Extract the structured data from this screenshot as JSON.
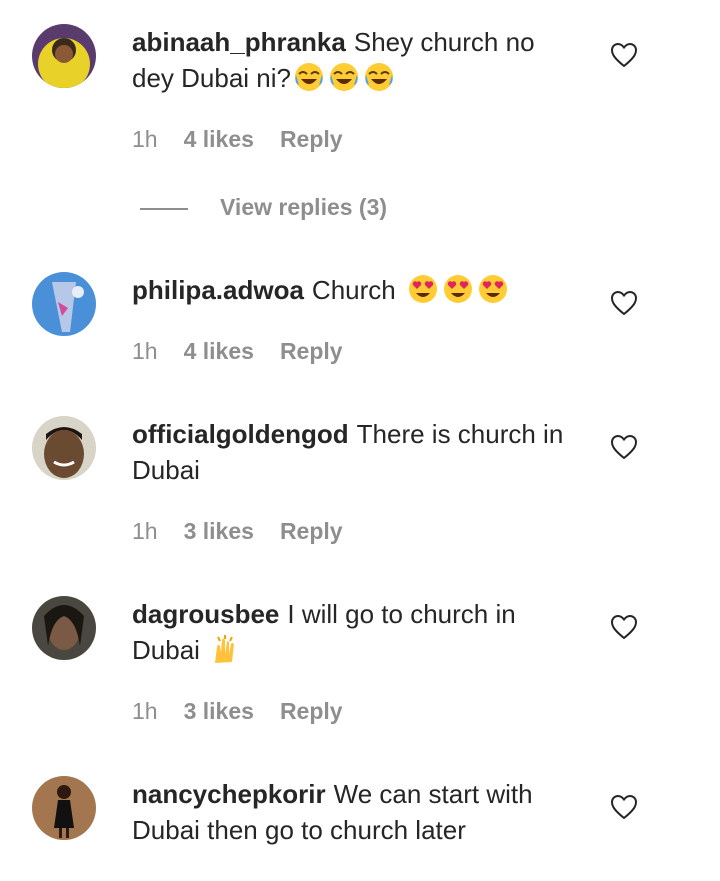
{
  "comments": [
    {
      "username": "abinaah_phranka",
      "text": "Shey church no dey Dubai ni?",
      "emojis": [
        "face-with-tears-of-joy",
        "face-with-tears-of-joy",
        "face-with-tears-of-joy"
      ],
      "time": "1h",
      "likes": "4 likes",
      "reply": "Reply",
      "view_replies": "View replies (3)",
      "avatar": "avatar-yellow"
    },
    {
      "username": "philipa.adwoa",
      "text": "Church",
      "emojis": [
        "smiling-face-with-heart-eyes",
        "smiling-face-with-heart-eyes",
        "smiling-face-with-heart-eyes"
      ],
      "time": "1h",
      "likes": "4 likes",
      "reply": "Reply",
      "avatar": "avatar-blue"
    },
    {
      "username": "officialgoldengod",
      "text": "There is church in Dubai",
      "emojis": [],
      "time": "1h",
      "likes": "3 likes",
      "reply": "Reply",
      "avatar": "avatar-man"
    },
    {
      "username": "dagrousbee",
      "text": "I will go to church in Dubai",
      "emojis": [
        "raising-hands"
      ],
      "time": "1h",
      "likes": "3 likes",
      "reply": "Reply",
      "avatar": "avatar-dark"
    },
    {
      "username": "nancychepkorir",
      "text": "We can start with Dubai then go to church later",
      "emojis": [],
      "avatar": "avatar-brown"
    }
  ],
  "colors": {
    "text": "#262626",
    "muted": "#8e8e8e",
    "background": "#ffffff"
  },
  "icons": {
    "like": "heart-outline-icon"
  }
}
